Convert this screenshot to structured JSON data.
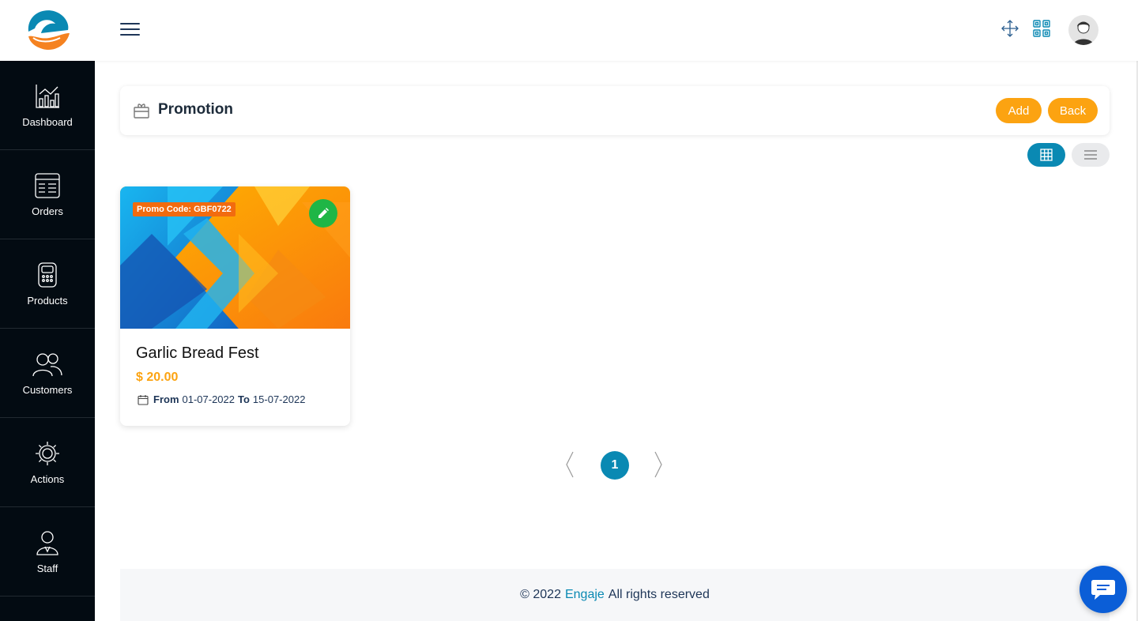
{
  "topbar": {
    "icons": [
      "logo-icon",
      "hamburger-icon",
      "fullscreen-icon",
      "qr-code-icon",
      "avatar-icon"
    ]
  },
  "sidebar": {
    "items": [
      {
        "label": "Dashboard",
        "icon": "chart-icon"
      },
      {
        "label": "Orders",
        "icon": "orders-list-icon"
      },
      {
        "label": "Products",
        "icon": "products-icon"
      },
      {
        "label": "Customers",
        "icon": "customers-icon"
      },
      {
        "label": "Actions",
        "icon": "gear-icon"
      },
      {
        "label": "Staff",
        "icon": "staff-icon"
      }
    ]
  },
  "header": {
    "title": "Promotion",
    "icon": "gift-box-icon",
    "add_label": "Add",
    "back_label": "Back"
  },
  "view_toggle": {
    "active": "grid",
    "icons": [
      "grid-view-icon",
      "list-view-icon"
    ]
  },
  "promotions": [
    {
      "badge": "Promo Code: GBF0722",
      "title": "Garlic Bread Fest",
      "price": "$ 20.00",
      "from_label": "From",
      "from_date": "01-07-2022",
      "to_label": "To",
      "to_date": "15-07-2022"
    }
  ],
  "pagination": {
    "current": "1"
  },
  "footer": {
    "prefix": "© 2022",
    "brand": "Engaje",
    "suffix": "All rights reserved"
  },
  "colors": {
    "accent": "#0a89b3",
    "button": "#fca311",
    "sidebar_bg": "#030b12",
    "badge": "#f26b0f",
    "edit": "#1fb646",
    "chat": "#0b5ed7"
  }
}
